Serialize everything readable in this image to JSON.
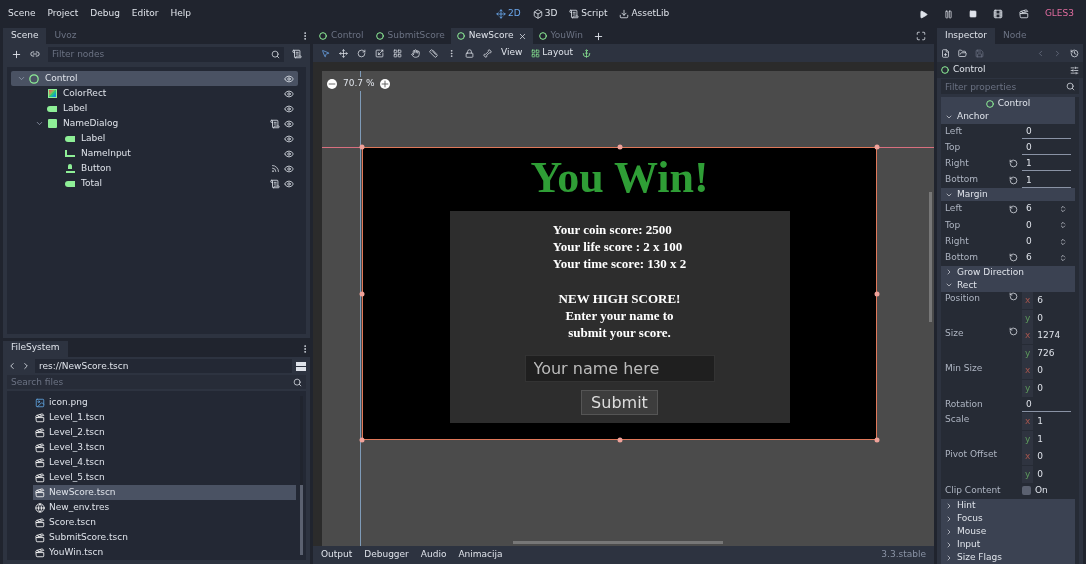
{
  "menu": [
    "Scene",
    "Project",
    "Debug",
    "Editor",
    "Help"
  ],
  "workspaces": [
    {
      "label": "2D",
      "kind": "twod",
      "selected": true
    },
    {
      "label": "3D",
      "kind": "threed",
      "selected": false
    },
    {
      "label": "Script",
      "kind": "script",
      "selected": false
    },
    {
      "label": "AssetLib",
      "kind": "assetlib",
      "selected": false
    }
  ],
  "renderer": "GLES3",
  "scene_dock": {
    "tabs": [
      {
        "label": "Scene",
        "selected": true
      },
      {
        "label": "Uvoz",
        "selected": false
      }
    ],
    "filter": {
      "placeholder": "Filter nodes"
    },
    "tree": [
      {
        "name": "Control",
        "kind": "control",
        "selected": true,
        "expanded": true,
        "script": false,
        "signals": false,
        "children": [
          {
            "name": "ColorRect",
            "kind": "colorrect",
            "selected": false,
            "script": false,
            "signals": false
          },
          {
            "name": "Label",
            "kind": "label",
            "selected": false,
            "script": false,
            "signals": false
          },
          {
            "name": "NameDialog",
            "kind": "container",
            "selected": false,
            "expanded": true,
            "script": true,
            "signals": false,
            "children": [
              {
                "name": "Label",
                "kind": "label",
                "selected": false,
                "script": false,
                "signals": false
              },
              {
                "name": "NameInput",
                "kind": "lineedit",
                "selected": false,
                "script": false,
                "signals": false
              },
              {
                "name": "Button",
                "kind": "button",
                "selected": false,
                "script": false,
                "signals": true
              },
              {
                "name": "Total",
                "kind": "label",
                "selected": false,
                "script": true,
                "signals": false
              }
            ]
          }
        ]
      }
    ]
  },
  "filesystem": {
    "tab": "FileSystem",
    "path": "res://NewScore.tscn",
    "search": {
      "placeholder": "Search files"
    },
    "files": [
      {
        "name": "icon.png",
        "kind": "image",
        "selected": false
      },
      {
        "name": "Level_1.tscn",
        "kind": "scene",
        "selected": false
      },
      {
        "name": "Level_2.tscn",
        "kind": "scene",
        "selected": false
      },
      {
        "name": "Level_3.tscn",
        "kind": "scene",
        "selected": false
      },
      {
        "name": "Level_4.tscn",
        "kind": "scene",
        "selected": false
      },
      {
        "name": "Level_5.tscn",
        "kind": "scene",
        "selected": false
      },
      {
        "name": "NewScore.tscn",
        "kind": "scene",
        "selected": true
      },
      {
        "name": "New_env.tres",
        "kind": "env",
        "selected": false
      },
      {
        "name": "Score.tscn",
        "kind": "scene",
        "selected": false
      },
      {
        "name": "SubmitScore.tscn",
        "kind": "scene",
        "selected": false
      },
      {
        "name": "YouWin.tscn",
        "kind": "scene",
        "selected": false
      }
    ]
  },
  "editor_tabs": [
    {
      "label": "Control",
      "selected": false
    },
    {
      "label": "SubmitScore",
      "selected": false
    },
    {
      "label": "NewScore",
      "selected": true
    },
    {
      "label": "YouWin",
      "selected": false
    }
  ],
  "toolbar": {
    "view": "View",
    "layout": "Layout"
  },
  "viewport": {
    "zoom": "70.7 %",
    "game": {
      "title": "You Win!",
      "scores": [
        "Your coin score: 2500",
        "Your life score : 2 x 100",
        "Your time score: 130 x 2"
      ],
      "message": [
        "NEW HIGH SCORE!",
        "Enter your name to",
        "submit your score."
      ],
      "name_input": {
        "placeholder": "Your name here"
      },
      "button": "Submit"
    }
  },
  "bottom_panel": {
    "tabs": [
      "Output",
      "Debugger",
      "Audio",
      "Animacija"
    ],
    "version": "3.3.stable"
  },
  "inspector": {
    "tabs": [
      {
        "label": "Inspector",
        "selected": true
      },
      {
        "label": "Node",
        "selected": false
      }
    ],
    "object": "Control",
    "filter": {
      "placeholder": "Filter properties"
    },
    "class": "Control",
    "items": [
      {
        "kind": "section",
        "label": "Anchor",
        "expanded": true
      },
      {
        "kind": "range",
        "label": "Left",
        "value": "0",
        "revert": false
      },
      {
        "kind": "range",
        "label": "Top",
        "value": "0",
        "revert": false
      },
      {
        "kind": "range",
        "label": "Right",
        "value": "1",
        "revert": true
      },
      {
        "kind": "range",
        "label": "Bottom",
        "value": "1",
        "revert": true
      },
      {
        "kind": "section",
        "label": "Margin",
        "expanded": true
      },
      {
        "kind": "spin",
        "label": "Left",
        "value": "6",
        "revert": true
      },
      {
        "kind": "spin",
        "label": "Top",
        "value": "0",
        "revert": false
      },
      {
        "kind": "spin",
        "label": "Right",
        "value": "0",
        "revert": false
      },
      {
        "kind": "spin",
        "label": "Bottom",
        "value": "6",
        "revert": true
      },
      {
        "kind": "section",
        "label": "Grow Direction",
        "expanded": false
      },
      {
        "kind": "section",
        "label": "Rect",
        "expanded": true
      },
      {
        "kind": "vector",
        "label": "Position",
        "components": [
          {
            "axis": "x",
            "value": "6"
          },
          {
            "axis": "y",
            "value": "0"
          }
        ],
        "revert": true
      },
      {
        "kind": "vector",
        "label": "Size",
        "components": [
          {
            "axis": "x",
            "value": "1274"
          },
          {
            "axis": "y",
            "value": "726"
          }
        ],
        "revert": true
      },
      {
        "kind": "vector",
        "label": "Min Size",
        "components": [
          {
            "axis": "x",
            "value": "0"
          },
          {
            "axis": "y",
            "value": "0"
          }
        ],
        "revert": false
      },
      {
        "kind": "range",
        "label": "Rotation",
        "value": "0",
        "revert": false
      },
      {
        "kind": "vector",
        "label": "Scale",
        "components": [
          {
            "axis": "x",
            "value": "1"
          },
          {
            "axis": "y",
            "value": "1"
          }
        ],
        "revert": false
      },
      {
        "kind": "vector",
        "label": "Pivot Offset",
        "components": [
          {
            "axis": "x",
            "value": "0"
          },
          {
            "axis": "y",
            "value": "0"
          }
        ],
        "revert": false
      },
      {
        "kind": "check",
        "label": "Clip Content",
        "text": "On",
        "checked": false
      },
      {
        "kind": "section",
        "label": "Hint",
        "expanded": false
      },
      {
        "kind": "section",
        "label": "Focus",
        "expanded": false
      },
      {
        "kind": "section",
        "label": "Mouse",
        "expanded": false
      },
      {
        "kind": "section",
        "label": "Input",
        "expanded": false
      },
      {
        "kind": "section",
        "label": "Size Flags",
        "expanded": false
      }
    ]
  }
}
